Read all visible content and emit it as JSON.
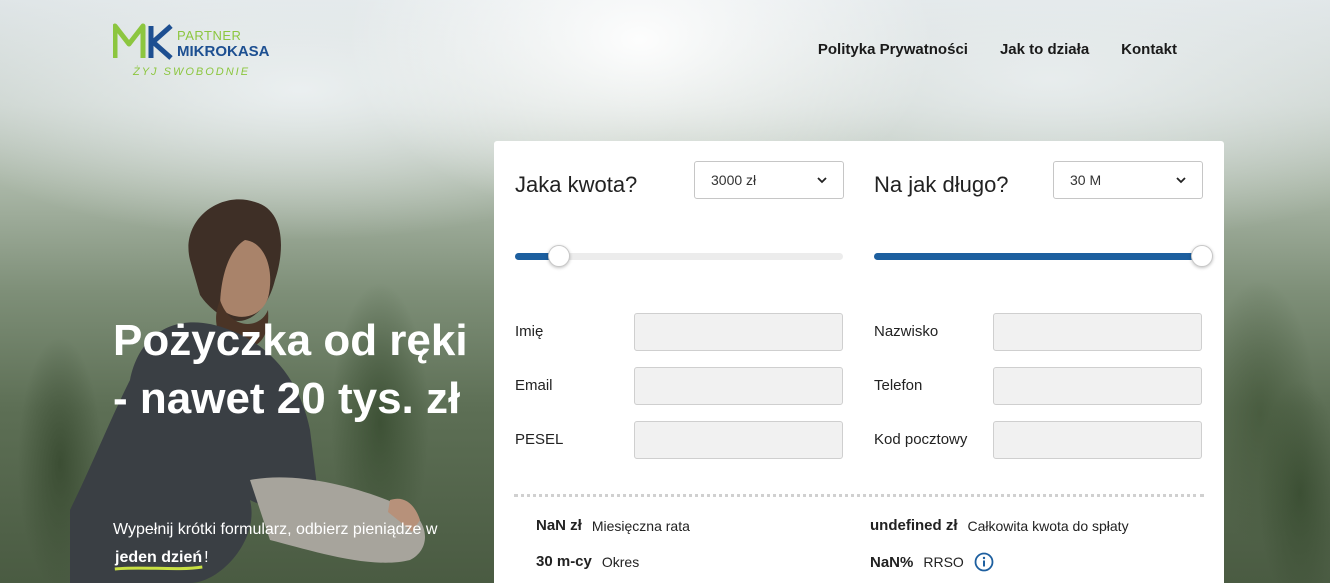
{
  "logo": {
    "partner": "PARTNER",
    "name": "MIKROKASA",
    "slogan": "ŻYJ SWOBODNIE",
    "colors": {
      "green": "#8cc63f",
      "blue": "#1d4f91"
    }
  },
  "nav": {
    "items": [
      {
        "label": "Polityka Prywatności"
      },
      {
        "label": "Jak to działa"
      },
      {
        "label": "Kontakt"
      }
    ]
  },
  "hero": {
    "title": "Pożyczka od ręki - nawet 20 tys. zł",
    "subtitle_before": "Wypełnij krótki formularz, odbierz pieniądze w",
    "subtitle_highlight": "jeden dzień",
    "subtitle_after": "!"
  },
  "form": {
    "amount": {
      "label": "Jaka kwota?",
      "selected": "3000 zł",
      "slider_fraction": 0.135
    },
    "period": {
      "label": "Na jak długo?",
      "selected": "30 M",
      "slider_fraction": 1.0
    },
    "fields": {
      "first_name": {
        "label": "Imię",
        "value": ""
      },
      "last_name": {
        "label": "Nazwisko",
        "value": ""
      },
      "email": {
        "label": "Email",
        "value": ""
      },
      "phone": {
        "label": "Telefon",
        "value": ""
      },
      "pesel": {
        "label": "PESEL",
        "value": ""
      },
      "postcode": {
        "label": "Kod pocztowy",
        "value": ""
      }
    },
    "summary": {
      "monthly": {
        "value": "NaN zł",
        "label": "Miesięczna rata"
      },
      "total": {
        "value": "undefined zł",
        "label": "Całkowita kwota do spłaty"
      },
      "period": {
        "value": "30 m-cy",
        "label": "Okres"
      },
      "rrso": {
        "value": "NaN%",
        "label": "RRSO"
      }
    }
  },
  "colors": {
    "accent": "#1d5f9f",
    "info": "#1d5f9f"
  }
}
